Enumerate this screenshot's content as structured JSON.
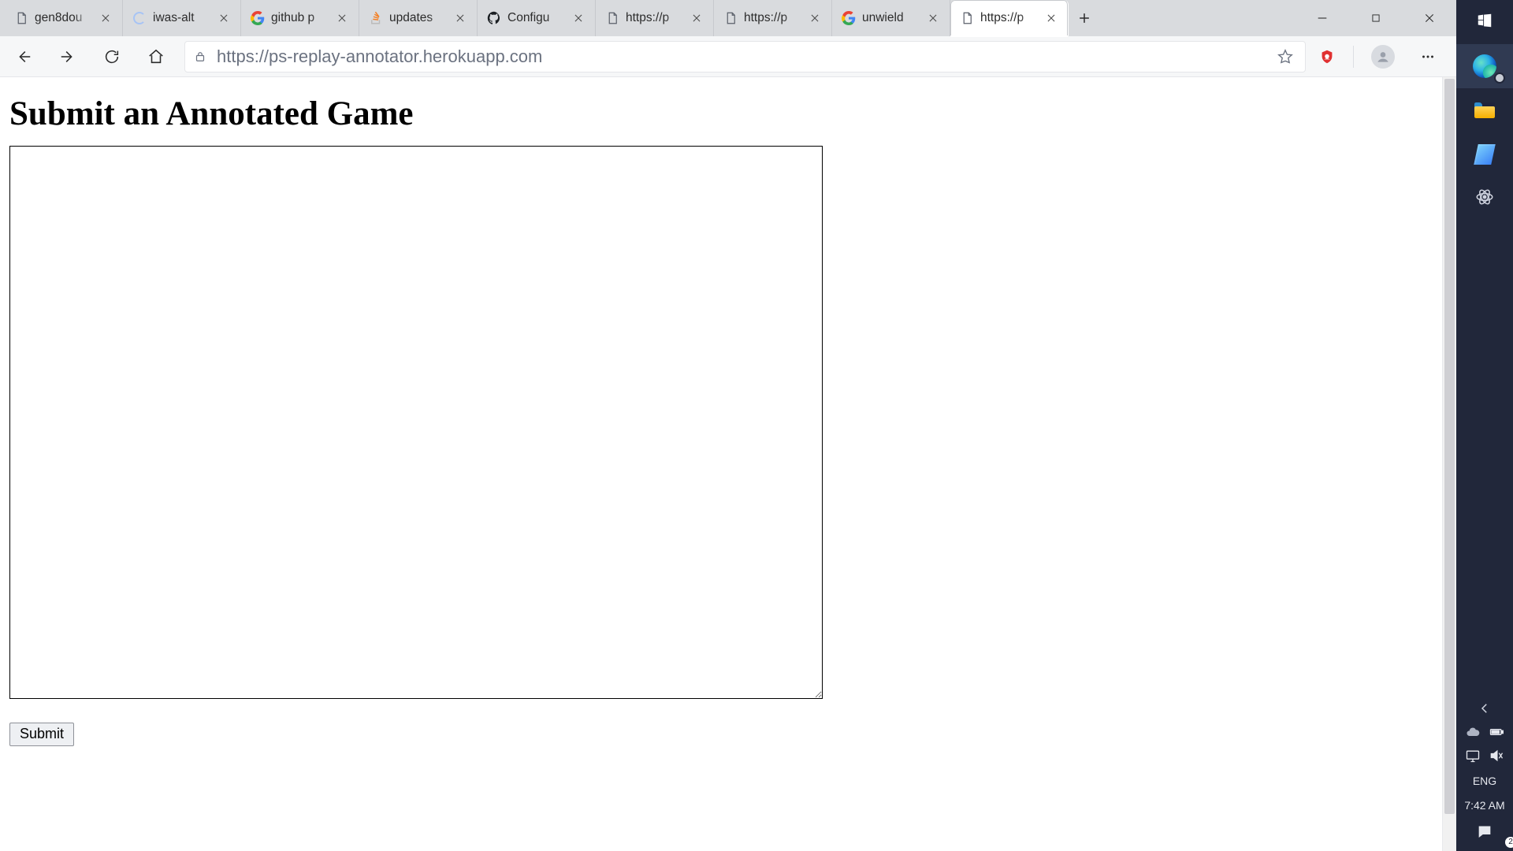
{
  "tabs": [
    {
      "label": "gen8dou",
      "favicon": "page"
    },
    {
      "label": "iwas-alt",
      "favicon": "loading"
    },
    {
      "label": "github p",
      "favicon": "google"
    },
    {
      "label": "updates",
      "favicon": "stackoverflow"
    },
    {
      "label": "Configu",
      "favicon": "github"
    },
    {
      "label": "https://p",
      "favicon": "page"
    },
    {
      "label": "https://p",
      "favicon": "page"
    },
    {
      "label": "unwield",
      "favicon": "google"
    },
    {
      "label": "https://p",
      "favicon": "page"
    }
  ],
  "active_tab_index": 8,
  "address": {
    "host": "https://ps-replay-annotator.herokuapp.com",
    "path": ""
  },
  "page": {
    "heading": "Submit an Annotated Game",
    "textarea_value": "",
    "submit_label": "Submit"
  },
  "sys": {
    "lang": "ENG",
    "time": "7:42 AM",
    "action_center_count": "2"
  }
}
